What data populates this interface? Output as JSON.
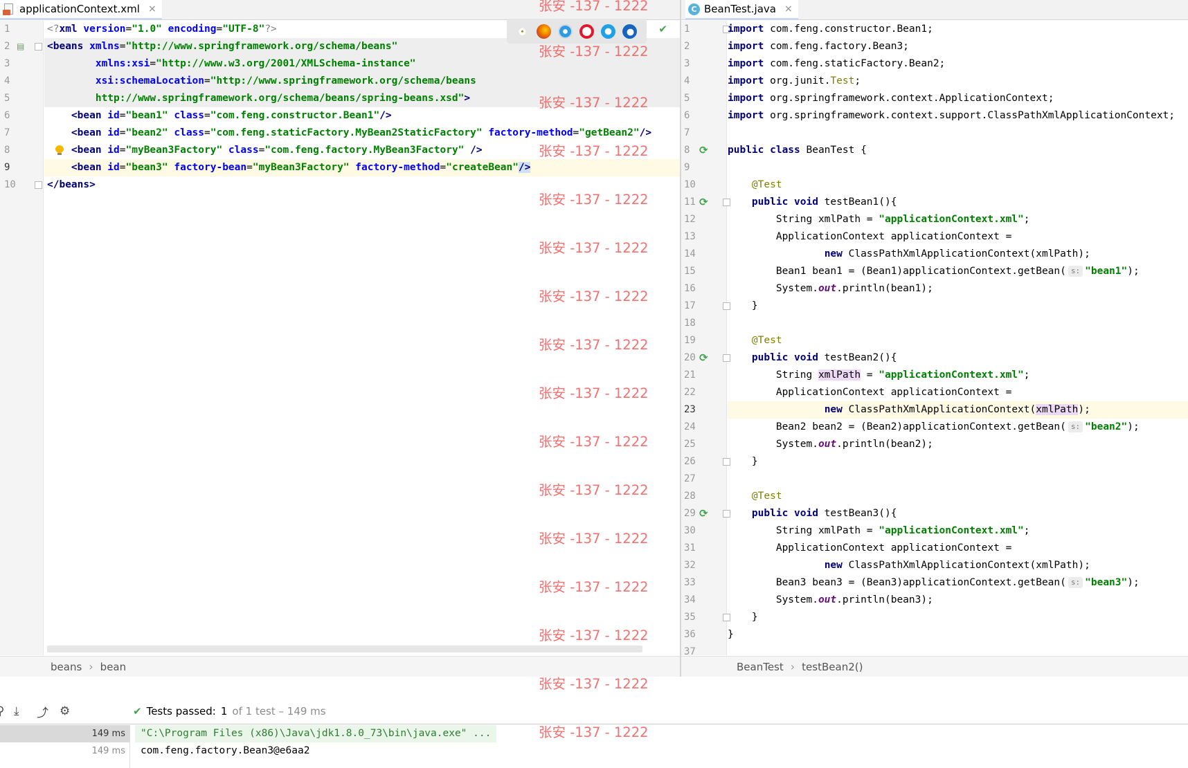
{
  "left_tab": {
    "title": "applicationContext.xml",
    "close": "×"
  },
  "right_tab": {
    "title": "BeanTest.java",
    "close": "×",
    "icon_letter": "C"
  },
  "xml_code": [
    {
      "n": "1",
      "tokens": [
        [
          "gray",
          "<?"
        ],
        [
          "kw",
          "xml"
        ],
        [
          "attr",
          " version"
        ],
        [
          "plain",
          "="
        ],
        [
          "str",
          "\"1.0\""
        ],
        [
          "attr",
          " encoding"
        ],
        [
          "plain",
          "="
        ],
        [
          "str",
          "\"UTF-8\""
        ],
        [
          "gray",
          "?>"
        ]
      ]
    },
    {
      "n": "2",
      "tokens": [
        [
          "tagn",
          "<beans"
        ],
        [
          "attr",
          " xmlns"
        ],
        [
          "plain",
          "="
        ],
        [
          "str",
          "\"http://www.springframework.org/schema/beans\""
        ]
      ]
    },
    {
      "n": "3",
      "tokens": [
        [
          "plain",
          "        "
        ],
        [
          "attr",
          "xmlns:xsi"
        ],
        [
          "plain",
          "="
        ],
        [
          "str",
          "\"http://www.w3.org/2001/XMLSchema-instance\""
        ]
      ]
    },
    {
      "n": "4",
      "tokens": [
        [
          "plain",
          "        "
        ],
        [
          "attr",
          "xsi:schemaLocation"
        ],
        [
          "plain",
          "="
        ],
        [
          "str",
          "\"http://www.springframework.org/schema/beans"
        ]
      ]
    },
    {
      "n": "5",
      "tokens": [
        [
          "plain",
          "        "
        ],
        [
          "str",
          "http://www.springframework.org/schema/beans/spring-beans.xsd\""
        ],
        [
          "tagn",
          ">"
        ]
      ]
    },
    {
      "n": "6",
      "tokens": [
        [
          "plain",
          "    "
        ],
        [
          "tagn",
          "<bean"
        ],
        [
          "attr",
          " id"
        ],
        [
          "plain",
          "="
        ],
        [
          "str",
          "\"bean1\""
        ],
        [
          "attr",
          " class"
        ],
        [
          "plain",
          "="
        ],
        [
          "str",
          "\"com.feng.constructor.Bean1\""
        ],
        [
          "tagn",
          "/>"
        ]
      ]
    },
    {
      "n": "7",
      "tokens": [
        [
          "plain",
          "    "
        ],
        [
          "tagn",
          "<bean"
        ],
        [
          "attr",
          " id"
        ],
        [
          "plain",
          "="
        ],
        [
          "str",
          "\"bean2\""
        ],
        [
          "attr",
          " class"
        ],
        [
          "plain",
          "="
        ],
        [
          "str",
          "\"com.feng.staticFactory.MyBean2StaticFactory\""
        ],
        [
          "attr",
          " factory-method"
        ],
        [
          "plain",
          "="
        ],
        [
          "str",
          "\"getBean2\""
        ],
        [
          "tagn",
          "/>"
        ]
      ]
    },
    {
      "n": "8",
      "tokens": [
        [
          "plain",
          "    "
        ],
        [
          "tagn",
          "<bean"
        ],
        [
          "attr",
          " id"
        ],
        [
          "plain",
          "="
        ],
        [
          "str",
          "\"myBean3Factory\""
        ],
        [
          "attr",
          " class"
        ],
        [
          "plain",
          "="
        ],
        [
          "str",
          "\"com.feng.factory.MyBean3Factory\""
        ],
        [
          "tagn",
          " />"
        ]
      ]
    },
    {
      "n": "9",
      "tokens": [
        [
          "plain",
          "    "
        ],
        [
          "tagn",
          "<bean"
        ],
        [
          "attr",
          " id"
        ],
        [
          "plain",
          "="
        ],
        [
          "str",
          "\"bean3\""
        ],
        [
          "attr",
          " factory-bean"
        ],
        [
          "plain",
          "="
        ],
        [
          "str",
          "\"myBean3Factory\""
        ],
        [
          "attr",
          " factory-method"
        ],
        [
          "plain",
          "="
        ],
        [
          "str",
          "\"createBean\""
        ],
        [
          "tagn",
          "/>"
        ]
      ]
    },
    {
      "n": "10",
      "tokens": [
        [
          "tagn",
          "</beans>"
        ]
      ]
    }
  ],
  "java_code": [
    {
      "n": "1",
      "tokens": [
        [
          "kw",
          "import"
        ],
        [
          "plain",
          " com.feng.constructor.Bean1;"
        ]
      ]
    },
    {
      "n": "2",
      "tokens": [
        [
          "kw",
          "import"
        ],
        [
          "plain",
          " com.feng.factory.Bean3;"
        ]
      ]
    },
    {
      "n": "3",
      "tokens": [
        [
          "kw",
          "import"
        ],
        [
          "plain",
          " com.feng.staticFactory.Bean2;"
        ]
      ]
    },
    {
      "n": "4",
      "tokens": [
        [
          "kw",
          "import"
        ],
        [
          "plain",
          " org.junit."
        ],
        [
          "ann",
          "Test"
        ],
        [
          "plain",
          ";"
        ]
      ]
    },
    {
      "n": "5",
      "tokens": [
        [
          "kw",
          "import"
        ],
        [
          "plain",
          " org.springframework.context.ApplicationContext;"
        ]
      ]
    },
    {
      "n": "6",
      "tokens": [
        [
          "kw",
          "import"
        ],
        [
          "plain",
          " org.springframework.context.support.ClassPathXmlApplicationContext;"
        ]
      ]
    },
    {
      "n": "7",
      "tokens": []
    },
    {
      "n": "8",
      "tokens": [
        [
          "kw",
          "public class"
        ],
        [
          "plain",
          " BeanTest {"
        ]
      ]
    },
    {
      "n": "9",
      "tokens": []
    },
    {
      "n": "10",
      "tokens": [
        [
          "plain",
          "    "
        ],
        [
          "ann",
          "@Test"
        ]
      ]
    },
    {
      "n": "11",
      "tokens": [
        [
          "plain",
          "    "
        ],
        [
          "kw",
          "public void"
        ],
        [
          "plain",
          " testBean1(){"
        ]
      ]
    },
    {
      "n": "12",
      "tokens": [
        [
          "plain",
          "        String xmlPath = "
        ],
        [
          "str",
          "\"applicationContext.xml\""
        ],
        [
          "plain",
          ";"
        ]
      ]
    },
    {
      "n": "13",
      "tokens": [
        [
          "plain",
          "        ApplicationContext applicationContext ="
        ]
      ]
    },
    {
      "n": "14",
      "tokens": [
        [
          "plain",
          "                "
        ],
        [
          "kw",
          "new"
        ],
        [
          "plain",
          " ClassPathXmlApplicationContext(xmlPath);"
        ]
      ]
    },
    {
      "n": "15",
      "tokens": [
        [
          "plain",
          "        Bean1 bean1 = (Bean1)applicationContext.getBean("
        ],
        [
          "hint",
          "s:"
        ],
        [
          "str",
          "\"bean1\""
        ],
        [
          "plain",
          ");"
        ]
      ]
    },
    {
      "n": "16",
      "tokens": [
        [
          "plain",
          "        System."
        ],
        [
          "ital",
          "out"
        ],
        [
          "plain",
          ".println(bean1);"
        ]
      ]
    },
    {
      "n": "17",
      "tokens": [
        [
          "plain",
          "    }"
        ]
      ]
    },
    {
      "n": "18",
      "tokens": []
    },
    {
      "n": "19",
      "tokens": [
        [
          "plain",
          "    "
        ],
        [
          "ann",
          "@Test"
        ]
      ]
    },
    {
      "n": "20",
      "tokens": [
        [
          "plain",
          "    "
        ],
        [
          "kw",
          "public void"
        ],
        [
          "plain",
          " testBean2(){"
        ]
      ]
    },
    {
      "n": "21",
      "tokens": [
        [
          "plain",
          "        String "
        ],
        [
          "usage",
          "xmlPath"
        ],
        [
          "plain",
          " = "
        ],
        [
          "str",
          "\"applicationContext.xml\""
        ],
        [
          "plain",
          ";"
        ]
      ]
    },
    {
      "n": "22",
      "tokens": [
        [
          "plain",
          "        ApplicationContext applicationContext ="
        ]
      ]
    },
    {
      "n": "23",
      "tokens": [
        [
          "plain",
          "                "
        ],
        [
          "kw",
          "new"
        ],
        [
          "plain",
          " ClassPathXmlApplicationContext("
        ],
        [
          "usage",
          "xmlPath"
        ],
        [
          "plain",
          ");"
        ]
      ]
    },
    {
      "n": "24",
      "tokens": [
        [
          "plain",
          "        Bean2 bean2 = (Bean2)applicationContext.getBean("
        ],
        [
          "hint",
          "s:"
        ],
        [
          "str",
          "\"bean2\""
        ],
        [
          "plain",
          ");"
        ]
      ]
    },
    {
      "n": "25",
      "tokens": [
        [
          "plain",
          "        System."
        ],
        [
          "ital",
          "out"
        ],
        [
          "plain",
          ".println(bean2);"
        ]
      ]
    },
    {
      "n": "26",
      "tokens": [
        [
          "plain",
          "    }"
        ]
      ]
    },
    {
      "n": "27",
      "tokens": []
    },
    {
      "n": "28",
      "tokens": [
        [
          "plain",
          "    "
        ],
        [
          "ann",
          "@Test"
        ]
      ]
    },
    {
      "n": "29",
      "tokens": [
        [
          "plain",
          "    "
        ],
        [
          "kw",
          "public void"
        ],
        [
          "plain",
          " testBean3(){"
        ]
      ]
    },
    {
      "n": "30",
      "tokens": [
        [
          "plain",
          "        String xmlPath = "
        ],
        [
          "str",
          "\"applicationContext.xml\""
        ],
        [
          "plain",
          ";"
        ]
      ]
    },
    {
      "n": "31",
      "tokens": [
        [
          "plain",
          "        ApplicationContext applicationContext ="
        ]
      ]
    },
    {
      "n": "32",
      "tokens": [
        [
          "plain",
          "                "
        ],
        [
          "kw",
          "new"
        ],
        [
          "plain",
          " ClassPathXmlApplicationContext(xmlPath);"
        ]
      ]
    },
    {
      "n": "33",
      "tokens": [
        [
          "plain",
          "        Bean3 bean3 = (Bean3)applicationContext.getBean("
        ],
        [
          "hint",
          "s:"
        ],
        [
          "str",
          "\"bean3\""
        ],
        [
          "plain",
          ");"
        ]
      ]
    },
    {
      "n": "34",
      "tokens": [
        [
          "plain",
          "        System."
        ],
        [
          "ital",
          "out"
        ],
        [
          "plain",
          ".println(bean3);"
        ]
      ]
    },
    {
      "n": "35",
      "tokens": [
        [
          "plain",
          "    }"
        ]
      ]
    },
    {
      "n": "36",
      "tokens": [
        [
          "plain",
          "}"
        ]
      ]
    },
    {
      "n": "37",
      "tokens": []
    }
  ],
  "left_breadcrumbs": [
    "beans",
    "bean"
  ],
  "right_breadcrumbs": [
    "BeanTest",
    "testBean2()"
  ],
  "breadcrumb_separator": "›",
  "test_status": {
    "label": "Tests passed:",
    "count": "1",
    "suffix": "of 1 test – 149 ms"
  },
  "test_tree": [
    {
      "time": "149 ms"
    },
    {
      "time": "149 ms"
    }
  ],
  "output": {
    "command": "\"C:\\Program Files (x86)\\Java\\jdk1.8.0_73\\bin\\java.exe\" ...",
    "result": "com.feng.factory.Bean3@e6aa2"
  },
  "watermark_text": "张安 -137 - 1222",
  "colors": {
    "keyword": "#000080",
    "string": "#008000",
    "attribute": "#0000ff",
    "annotation": "#808000",
    "watermark": "#f05a5a",
    "pass": "#3fa34d",
    "current_line": "#fffae3"
  },
  "icons": {
    "xml_file": "xml-file-icon",
    "java_class": "java-class-icon",
    "run_test": "run-test-icon",
    "intention_bulb": "bulb-icon",
    "browsers": [
      "chrome-icon",
      "firefox-icon",
      "safari-icon",
      "opera-icon",
      "ie-icon",
      "edge-icon"
    ],
    "toolbar": [
      "search-icon",
      "import-icon",
      "export-icon",
      "settings-icon"
    ],
    "passed": "check-icon"
  }
}
